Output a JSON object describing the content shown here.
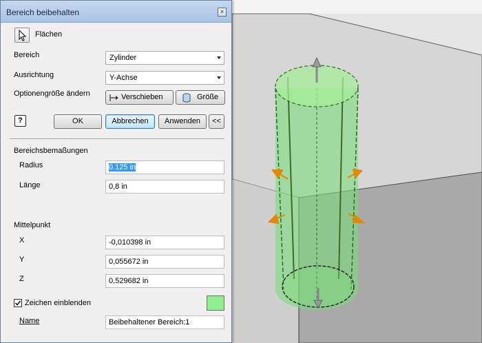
{
  "dialog": {
    "title": "Bereich beibehalten",
    "close_glyph": "×",
    "faces_label": "Flächen",
    "region_label": "Bereich",
    "region_value": "Zylinder",
    "orientation_label": "Ausrichtung",
    "orientation_value": "Y-Achse",
    "resize_label": "Optionengröße ändern",
    "move_button": "Verschieben",
    "size_button": "Größe",
    "help_glyph": "?",
    "ok_button": "OK",
    "cancel_button": "Abbrechen",
    "apply_button": "Anwenden",
    "collapse_button": "<<",
    "dimensions_header": "Bereichsbemaßungen",
    "radius_label": "Radius",
    "radius_value": "0.125 in",
    "length_label": "Länge",
    "length_value": "0,8 in",
    "center_header": "Mittelpunkt",
    "x_label": "X",
    "x_value": "-0,010398 in",
    "y_label": "Y",
    "y_value": "0,055672 in",
    "z_label": "Z",
    "z_value": "0,529682 in",
    "show_glyphs_label": "Zeichen einblenden",
    "show_glyphs_checked": true,
    "glyph_color": "#90ee90",
    "name_label": "Name",
    "name_value": "Beibehaltener Bereich:1"
  },
  "viewport": {
    "icons": [
      "move-arrow-icon",
      "resize-handle-icon"
    ],
    "cylinder_color": "#7ddc7d",
    "handle_color": "#e08a00"
  }
}
